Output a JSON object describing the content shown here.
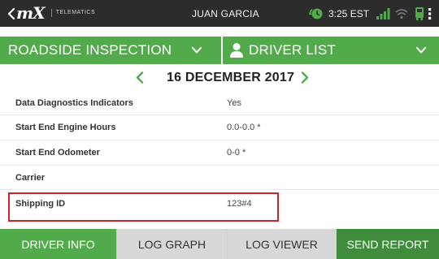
{
  "statusbar": {
    "logo_text": "mX",
    "logo_sub": "TELEMATICS",
    "driver_name": "JUAN GARCIA",
    "time": "3:25 EST"
  },
  "nav": {
    "left_label": "ROADSIDE INSPECTION",
    "right_label": "DRIVER LIST"
  },
  "date": {
    "label": "16 DECEMBER 2017"
  },
  "rows": [
    {
      "label": "Data Diagnostics Indicators",
      "value": "Yes"
    },
    {
      "label": "Start End Engine Hours",
      "value": "0.0-0.0 *"
    },
    {
      "label": "Start End Odometer",
      "value": "0-0 *"
    },
    {
      "label": "Carrier",
      "value": ""
    },
    {
      "label": "Shipping ID",
      "value": "123#4"
    }
  ],
  "tabs": {
    "driver_info": "DRIVER INFO",
    "log_graph": "LOG GRAPH",
    "log_viewer": "LOG VIEWER",
    "send_report": "SEND REPORT"
  },
  "colors": {
    "brand_green": "#52ab4a",
    "dark_green": "#3f8c3a",
    "statusbar": "#2c2c2c",
    "highlight_red": "#c8252b"
  },
  "icons": [
    "chevron-left-icon",
    "history-clock-icon",
    "signal-bars-icon",
    "wifi-icon",
    "truck-icon",
    "more-vertical-icon",
    "chevron-down-icon",
    "person-icon",
    "chevron-right-icon"
  ]
}
